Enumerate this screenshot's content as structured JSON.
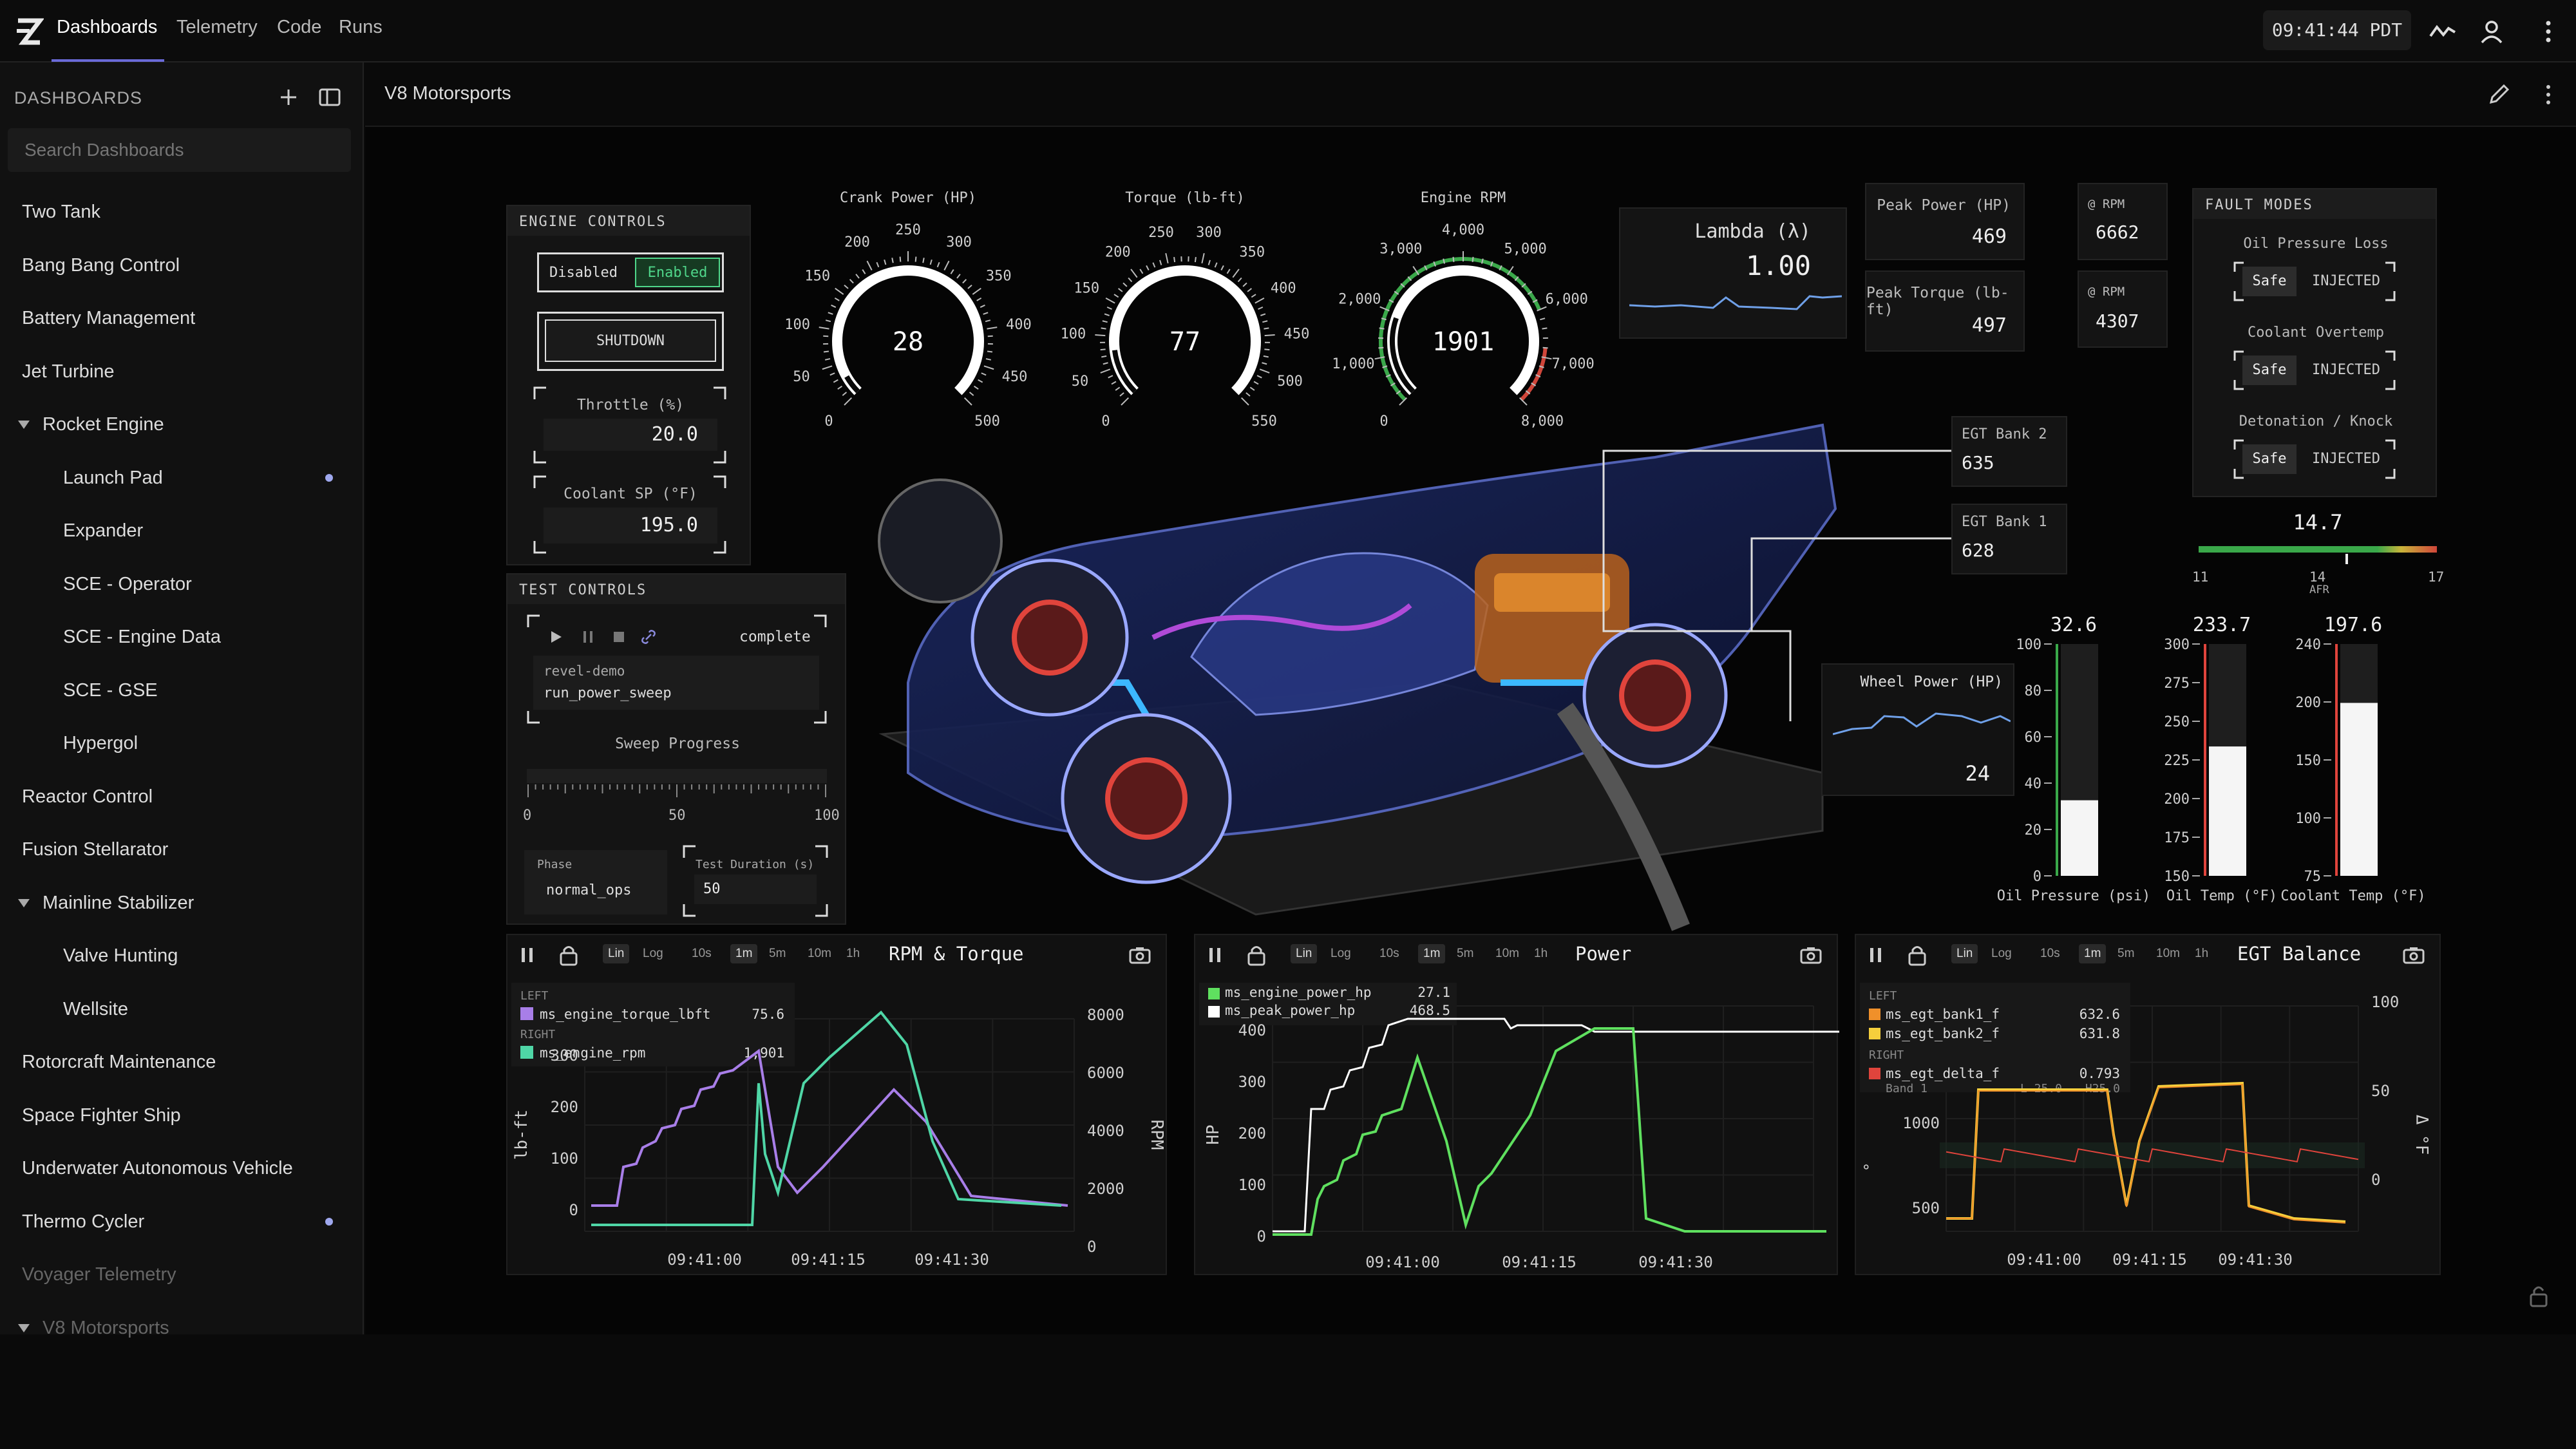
{
  "nav": {
    "tabs": [
      "Dashboards",
      "Telemetry",
      "Code",
      "Runs"
    ],
    "clock": "09:41:44 PDT"
  },
  "sidebar": {
    "title": "DASHBOARDS",
    "search_placeholder": "Search Dashboards",
    "items": [
      {
        "label": "Two Tank",
        "level": "top"
      },
      {
        "label": "Bang Bang Control",
        "level": "top"
      },
      {
        "label": "Battery Management",
        "level": "top"
      },
      {
        "label": "Jet Turbine",
        "level": "top"
      },
      {
        "label": "Rocket Engine",
        "level": "caret"
      },
      {
        "label": "Launch Pad",
        "level": "child",
        "dot": true
      },
      {
        "label": "Expander",
        "level": "child"
      },
      {
        "label": "SCE - Operator",
        "level": "child"
      },
      {
        "label": "SCE - Engine Data",
        "level": "child"
      },
      {
        "label": "SCE - GSE",
        "level": "child"
      },
      {
        "label": "Hypergol",
        "level": "child"
      },
      {
        "label": "Reactor Control",
        "level": "top"
      },
      {
        "label": "Fusion Stellarator",
        "level": "top"
      },
      {
        "label": "Mainline Stabilizer",
        "level": "caret"
      },
      {
        "label": "Valve Hunting",
        "level": "child"
      },
      {
        "label": "Wellsite",
        "level": "child"
      },
      {
        "label": "Rotorcraft Maintenance",
        "level": "top"
      },
      {
        "label": "Space Fighter Ship",
        "level": "top"
      },
      {
        "label": "Underwater Autonomous Vehicle",
        "level": "top"
      },
      {
        "label": "Thermo Cycler",
        "level": "top",
        "dot": true
      },
      {
        "label": "Voyager Telemetry",
        "level": "top",
        "dim": true
      },
      {
        "label": "V8 Motorsports",
        "level": "caret",
        "dim": true
      }
    ]
  },
  "breadcrumb": "V8 Motorsports",
  "engine_controls": {
    "title": "ENGINE CONTROLS",
    "disabled": "Disabled",
    "enabled": "Enabled",
    "shutdown": "SHUTDOWN",
    "throttle_label": "Throttle (%)",
    "throttle_value": "20.0",
    "coolant_label": "Coolant SP (°F)",
    "coolant_value": "195.0"
  },
  "test_controls": {
    "title": "TEST CONTROLS",
    "status": "complete",
    "script_line1": "revel-demo",
    "script_line2": "run_power_sweep",
    "sweep_label": "Sweep Progress",
    "sweep_min": "0",
    "sweep_mid": "50",
    "sweep_max": "100",
    "sweep_progress": 0,
    "phase_label": "Phase",
    "phase_value": "normal_ops",
    "duration_label": "Test Duration (s)",
    "duration_value": "50"
  },
  "gauges": [
    {
      "title": "Crank Power (HP)",
      "value": "28",
      "min": 0,
      "max": 500,
      "ticks": [
        "0",
        "50",
        "100",
        "150",
        "200",
        "250",
        "300",
        "350",
        "400",
        "450",
        "500"
      ],
      "fraction": 0.056
    },
    {
      "title": "Torque (lb-ft)",
      "value": "77",
      "min": 0,
      "max": 550,
      "ticks": [
        "0",
        "50",
        "100",
        "150",
        "200",
        "250",
        "300",
        "350",
        "400",
        "450",
        "500",
        "550"
      ],
      "fraction": 0.14
    },
    {
      "title": "Engine RPM",
      "value": "1901",
      "min": 0,
      "max": 8000,
      "ticks": [
        "0",
        "1,000",
        "2,000",
        "3,000",
        "4,000",
        "5,000",
        "6,000",
        "7,000",
        "8,000"
      ],
      "fraction": 0.2376
    }
  ],
  "lambda": {
    "label": "Lambda (λ)",
    "value": "1.00"
  },
  "peaks": {
    "power_label": "Peak Power (HP)",
    "power_value": "469",
    "power_rpm_label": "@ RPM",
    "power_rpm_value": "6662",
    "torque_label": "Peak Torque (lb-ft)",
    "torque_value": "497",
    "torque_rpm_label": "@ RPM",
    "torque_rpm_value": "4307"
  },
  "fault_modes": {
    "title": "FAULT MODES",
    "items": [
      {
        "label": "Oil Pressure Loss",
        "safe": "Safe",
        "injected": "INJECTED"
      },
      {
        "label": "Coolant Overtemp",
        "safe": "Safe",
        "injected": "INJECTED"
      },
      {
        "label": "Detonation / Knock",
        "safe": "Safe",
        "injected": "INJECTED"
      }
    ]
  },
  "afr": {
    "value": "14.7",
    "min": "11",
    "mid": "14",
    "max": "17",
    "label": "AFR",
    "fraction": 0.617
  },
  "egt_labels": [
    {
      "label": "EGT Bank 2",
      "value": "635"
    },
    {
      "label": "EGT Bank 1",
      "value": "628"
    }
  ],
  "wheel_power": {
    "label": "Wheel Power (HP)",
    "value": "24"
  },
  "bars": [
    {
      "label": "Oil Pressure (psi)",
      "value": "32.6",
      "ticks": [
        "100",
        "80",
        "60",
        "40",
        "20",
        "0"
      ],
      "fraction": 0.326
    },
    {
      "label": "Oil Temp (°F)",
      "value": "233.7",
      "ticks": [
        "300",
        "275",
        "250",
        "225",
        "200",
        "175",
        "150"
      ],
      "fraction": 0.558
    },
    {
      "label": "Coolant Temp (°F)",
      "value": "197.6",
      "ticks": [
        "240",
        "200",
        "150",
        "100",
        "75"
      ],
      "fraction": 0.746
    }
  ],
  "charts": {
    "rpm_torque": {
      "title": "RPM & Torque",
      "left_label": "LEFT",
      "right_label": "RIGHT",
      "series": [
        {
          "name": "ms_engine_torque_lbft",
          "value": "75.6",
          "color": "#a87ee8"
        },
        {
          "name": "ms_engine_rpm",
          "value": "1,901",
          "color": "#4fd6a6"
        }
      ],
      "ylabel_left": "lb-ft",
      "ylabel_right": "RPM",
      "yticks_left": [
        "300",
        "200",
        "100",
        "0"
      ],
      "yticks_right": [
        "8000",
        "6000",
        "4000",
        "2000",
        "0"
      ],
      "xticks": [
        "09:41:00",
        "09:41:15",
        "09:41:30"
      ]
    },
    "power": {
      "title": "Power",
      "series": [
        {
          "name": "ms_engine_power_hp",
          "value": "27.1",
          "color": "#5fe05f"
        },
        {
          "name": "ms_peak_power_hp",
          "value": "468.5",
          "color": "#ffffff"
        }
      ],
      "ylabel": "HP",
      "yticks": [
        "400",
        "300",
        "200",
        "100",
        "0"
      ],
      "xticks": [
        "09:41:00",
        "09:41:15",
        "09:41:30"
      ]
    },
    "egt": {
      "title": "EGT Balance",
      "left_label": "LEFT",
      "right_label": "RIGHT",
      "series": [
        {
          "name": "ms_egt_bank1_f",
          "value": "632.6",
          "color": "#f0902a"
        },
        {
          "name": "ms_egt_bank2_f",
          "value": "631.8",
          "color": "#f5cf3c"
        },
        {
          "name": "ms_egt_delta_f",
          "value": "0.793",
          "color": "#e0443c"
        }
      ],
      "band_label": "Band 1",
      "band_lo": "L-25.0",
      "band_hi": "H25.0",
      "ylabel_left": "°",
      "ylabel_right": "Δ °F",
      "yticks_left": [
        "1000",
        "500"
      ],
      "yticks_right": [
        "100",
        "50",
        "0"
      ],
      "xticks": [
        "09:41:00",
        "09:41:15",
        "09:41:30"
      ]
    },
    "toolbar": {
      "lin": "Lin",
      "log": "Log",
      "ranges": [
        "10s",
        "1m",
        "5m",
        "10m",
        "1h"
      ],
      "selected": "1m"
    }
  },
  "colors": {
    "accent": "#6a6ad8",
    "green": "#4fd6a6",
    "red": "#e0443c",
    "purple": "#a87ee8"
  }
}
